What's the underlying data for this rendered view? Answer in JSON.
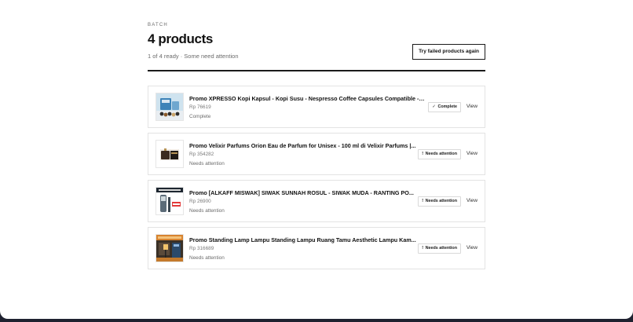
{
  "header": {
    "eyebrow": "BATCH",
    "title": "4 products",
    "subtitle": "1 of 4 ready · Some need attention",
    "retry_label": "Try failed products again"
  },
  "products": [
    {
      "name": "Promo XPRESSO Kopi Kapsul - Kopi Susu - Nespresso Coffee Capsules Compatible - 1...",
      "price": "Rp 76619",
      "status": "Complete",
      "badge_glyph": "✓",
      "badge_label": "Complete",
      "view_label": "View",
      "thumb_icon": "coffee-capsule-product-icon"
    },
    {
      "name": "Promo Velixir Parfums Orion Eau de Parfum for Unisex - 100 ml di Velixir Parfums |...",
      "price": "Rp 354282",
      "status": "Needs attention",
      "badge_glyph": "!",
      "badge_label": "Needs attention",
      "view_label": "View",
      "thumb_icon": "perfume-product-icon"
    },
    {
      "name": "Promo [ALKAFF MISWAK] SIWAK SUNNAH ROSUL - SIWAK MUDA - RANTING PO...",
      "price": "Rp 26900",
      "status": "Needs attention",
      "badge_glyph": "!",
      "badge_label": "Needs attention",
      "view_label": "View",
      "thumb_icon": "miswak-product-icon"
    },
    {
      "name": "Promo Standing Lamp Lampu Standing Lampu Ruang Tamu Aesthetic Lampu Kam...",
      "price": "Rp 316689",
      "status": "Needs attention",
      "badge_glyph": "!",
      "badge_label": "Needs attention",
      "view_label": "View",
      "thumb_icon": "standing-lamp-product-icon"
    }
  ]
}
